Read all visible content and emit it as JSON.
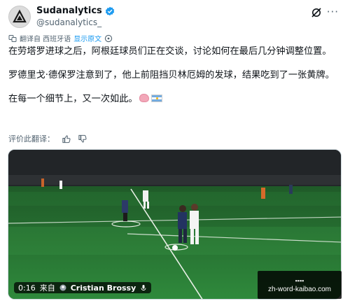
{
  "author": {
    "display_name": "Sudanalytics",
    "handle": "@sudanalytics_",
    "verified_color": "#1d9bf0"
  },
  "icons": {
    "verified": "verified-badge-icon",
    "grok": "grok-icon",
    "more": "more-icon",
    "translate": "translate-icon",
    "info": "info-icon",
    "thumbs_up": "thumbs-up-icon",
    "thumbs_down": "thumbs-down-icon",
    "voice": "voice-icon"
  },
  "translation_bar": {
    "label": "翻译自 西班牙语",
    "show_original": "显示原文"
  },
  "tweet": {
    "paragraph_1": "在劳塔罗进球之后，阿根廷球员们正在交谈，讨论如何在最后几分钟调整位置。",
    "paragraph_2": "罗德里戈·德保罗注意到了，他上前阻挡贝林厄姆的发球，结果吃到了一张黄牌。",
    "paragraph_3": "在每一个细节上，又一次如此。"
  },
  "rate_translation": {
    "label": "评价此翻译："
  },
  "video": {
    "time": "0:16",
    "from": "来自",
    "creator": "Cristian Brossy"
  },
  "watermark": {
    "top": "▪▪▪▪",
    "text": "zh-word-kaibao.com"
  },
  "colors": {
    "accent": "#1d9bf0",
    "text": "#0f1419",
    "secondary": "#536471",
    "pitch": "#2f8a3c"
  }
}
